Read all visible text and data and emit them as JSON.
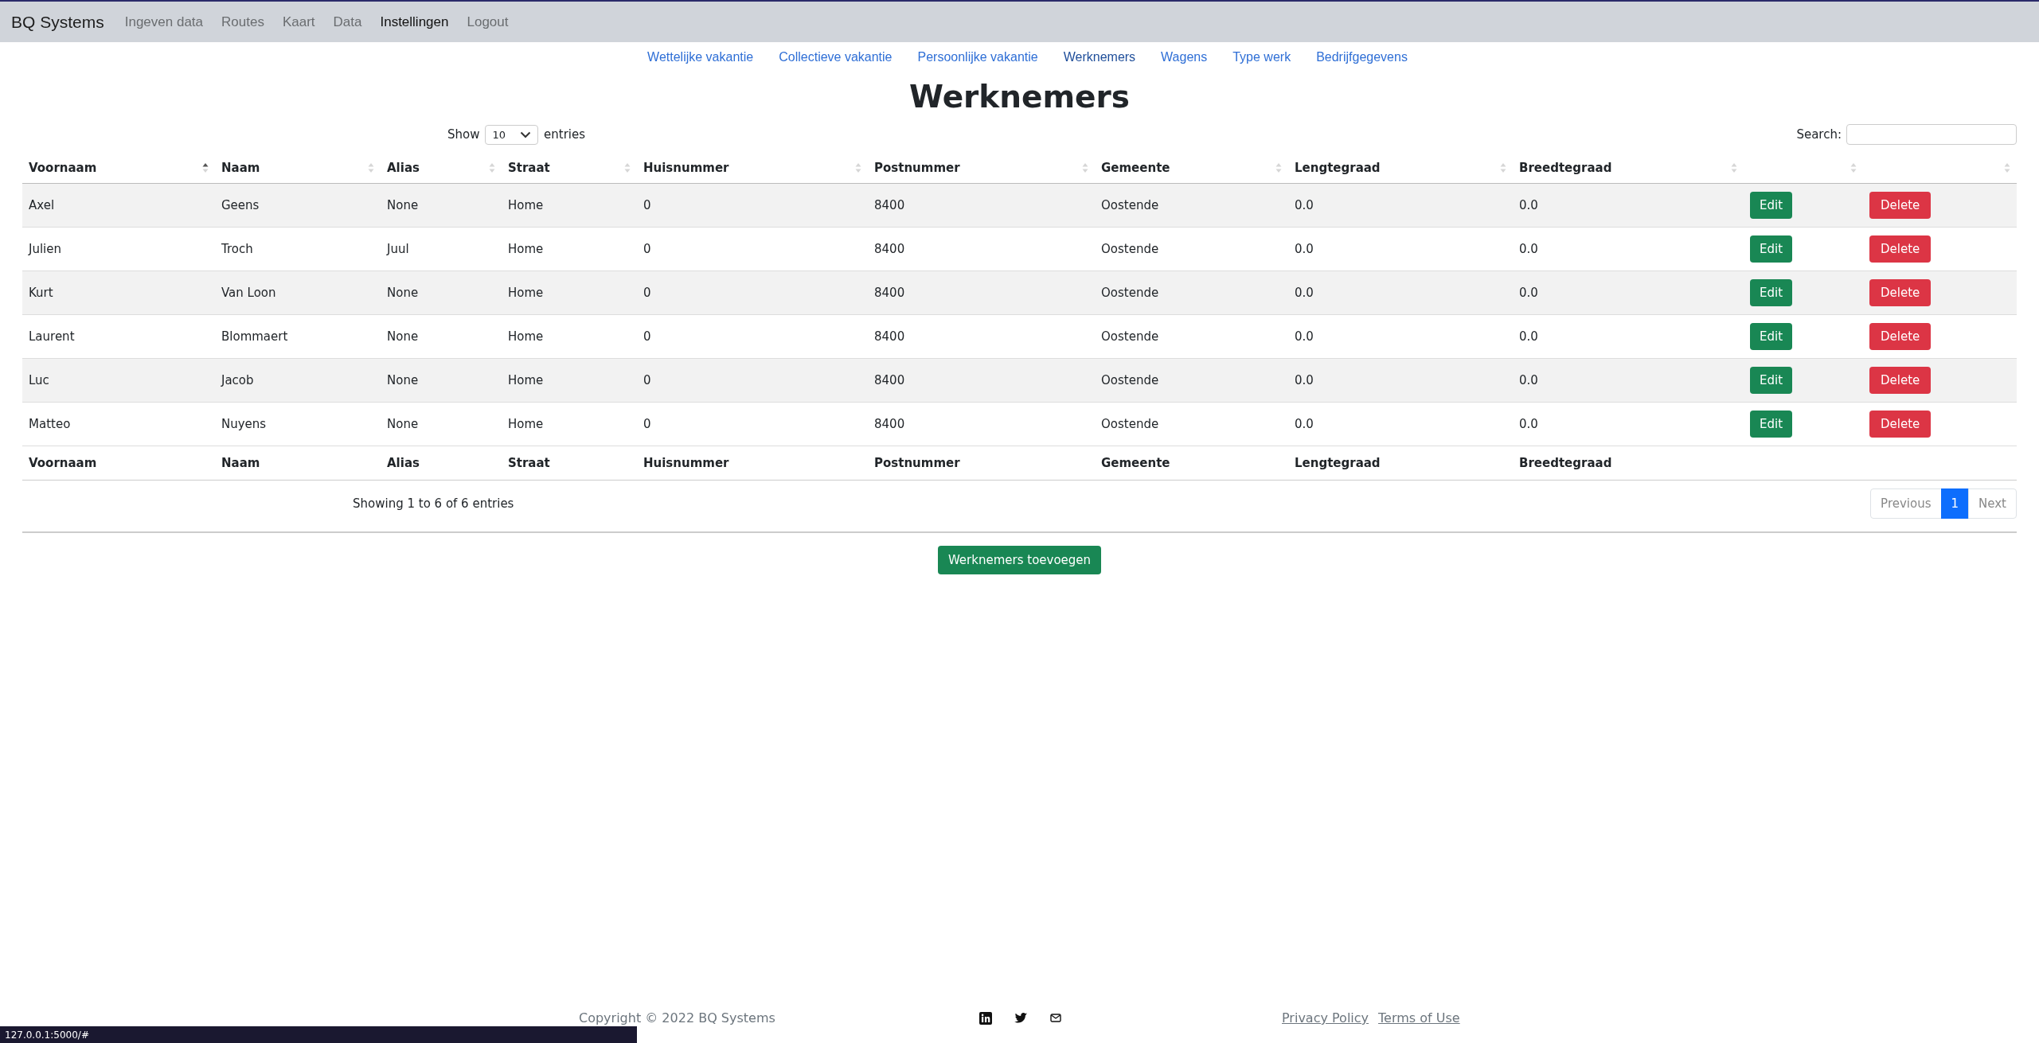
{
  "navbar": {
    "brand": "BQ Systems",
    "items": [
      {
        "label": "Ingeven data",
        "selected": false
      },
      {
        "label": "Routes",
        "selected": false
      },
      {
        "label": "Kaart",
        "selected": false
      },
      {
        "label": "Data",
        "selected": false
      },
      {
        "label": "Instellingen",
        "selected": true
      },
      {
        "label": "Logout",
        "selected": false
      }
    ]
  },
  "subnav": [
    {
      "label": "Wettelijke vakantie",
      "selected": false
    },
    {
      "label": "Collectieve vakantie",
      "selected": false
    },
    {
      "label": "Persoonlijke vakantie",
      "selected": false
    },
    {
      "label": "Werknemers",
      "selected": true
    },
    {
      "label": "Wagens",
      "selected": false
    },
    {
      "label": "Type werk",
      "selected": false
    },
    {
      "label": "Bedrijfgegevens",
      "selected": false
    }
  ],
  "title": "Werknemers",
  "length_control": {
    "prefix": "Show",
    "value": "10",
    "suffix": "entries"
  },
  "search": {
    "label": "Search:"
  },
  "table": {
    "columns": [
      {
        "label": "Voornaam",
        "selected": true
      },
      {
        "label": "Naam",
        "selected": false
      },
      {
        "label": "Alias",
        "selected": false
      },
      {
        "label": "Straat",
        "selected": false
      },
      {
        "label": "Huisnummer",
        "selected": false
      },
      {
        "label": "Postnummer",
        "selected": false
      },
      {
        "label": "Gemeente",
        "selected": false
      },
      {
        "label": "Lengtegraad",
        "selected": false
      },
      {
        "label": "Breedtegraad",
        "selected": false
      },
      {
        "selected": false
      },
      {
        "selected": false
      }
    ],
    "rows": [
      {
        "cells": [
          "Axel",
          "Geens",
          "None",
          "Home",
          "0",
          "8400",
          "Oostende",
          "0.0",
          "0.0"
        ],
        "edit": "Edit",
        "delete": "Delete"
      },
      {
        "cells": [
          "Julien",
          "Troch",
          "Juul",
          "Home",
          "0",
          "8400",
          "Oostende",
          "0.0",
          "0.0"
        ],
        "edit": "Edit",
        "delete": "Delete"
      },
      {
        "cells": [
          "Kurt",
          "Van Loon",
          "None",
          "Home",
          "0",
          "8400",
          "Oostende",
          "0.0",
          "0.0"
        ],
        "edit": "Edit",
        "delete": "Delete"
      },
      {
        "cells": [
          "Laurent",
          "Blommaert",
          "None",
          "Home",
          "0",
          "8400",
          "Oostende",
          "0.0",
          "0.0"
        ],
        "edit": "Edit",
        "delete": "Delete"
      },
      {
        "cells": [
          "Luc",
          "Jacob",
          "None",
          "Home",
          "0",
          "8400",
          "Oostende",
          "0.0",
          "0.0"
        ],
        "edit": "Edit",
        "delete": "Delete"
      },
      {
        "cells": [
          "Matteo",
          "Nuyens",
          "None",
          "Home",
          "0",
          "8400",
          "Oostende",
          "0.0",
          "0.0"
        ],
        "edit": "Edit",
        "delete": "Delete"
      }
    ],
    "footer": [
      "Voornaam",
      "Naam",
      "Alias",
      "Straat",
      "Huisnummer",
      "Postnummer",
      "Gemeente",
      "Lengtegraad",
      "Breedtegraad"
    ]
  },
  "info": "Showing 1 to 6 of 6 entries",
  "pagination": [
    {
      "label": "Previous",
      "selected": false,
      "disabled": true
    },
    {
      "label": "1",
      "selected": true,
      "disabled": false
    },
    {
      "label": "Next",
      "selected": false,
      "disabled": true
    }
  ],
  "add_button": "Werknemers toevoegen",
  "page_footer": {
    "copyright": "Copyright © 2022 BQ Systems",
    "links": [
      "Privacy Policy",
      "Terms of Use"
    ]
  },
  "status_bar": "127.0.0.1:5000/#"
}
